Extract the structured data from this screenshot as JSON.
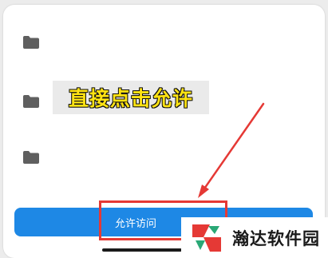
{
  "file_list": {
    "items": [
      {
        "icon": "folder-icon",
        "label": ""
      },
      {
        "icon": "folder-icon",
        "label": ""
      },
      {
        "icon": "folder-icon",
        "label": ""
      }
    ]
  },
  "annotation": {
    "text": "直接点击允许",
    "color": "#ffe313"
  },
  "action": {
    "allow_button_label": "允许访问",
    "button_color": "#1e88e5",
    "highlight_color": "#e53935"
  },
  "watermark": {
    "text": "瀚达软件园"
  }
}
